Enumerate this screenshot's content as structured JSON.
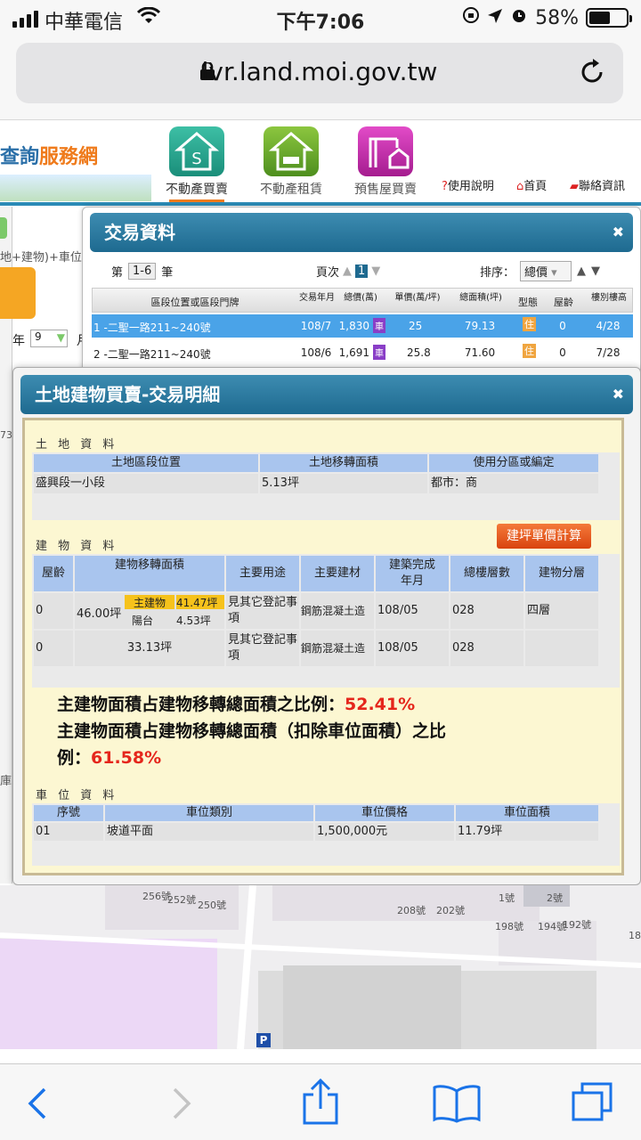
{
  "status": {
    "carrier": "中華電信",
    "time": "下午7:06",
    "battery": "58%"
  },
  "browser": {
    "url": "lvr.land.moi.gov.tw"
  },
  "site": {
    "logo_a": "查詢",
    "logo_b": "服務網",
    "nav": [
      "不動產買賣",
      "不動產租賃",
      "預售屋買賣"
    ],
    "links": [
      "使用說明",
      "首頁",
      "聯絡資訊"
    ]
  },
  "left": {
    "frag1": "地+建物)+車位",
    "year_label": "年",
    "month_val": "9",
    "month_label": "月",
    "f73": "73",
    "frag_sha": "庫"
  },
  "tx": {
    "title": "交易資料",
    "page_prefix": "第",
    "range": "1-6",
    "page_suffix": "筆",
    "page_label": "頁次",
    "page_num": "1",
    "sort_label": "排序：",
    "sort_value": "總價",
    "headers": [
      "區段位置或區段門牌",
      "交易年月",
      "總價(萬)",
      "單價(萬/坪)",
      "總面積(坪)",
      "型態",
      "屋齡",
      "樓別樓高"
    ],
    "rows": [
      {
        "addr": "1 -二聖一路211~240號",
        "ym": "108/7",
        "total": "1,830",
        "unit": "25",
        "area": "79.13",
        "type": "住",
        "age": "0",
        "floor": "4/28"
      },
      {
        "addr": "2 -二聖一路211~240號",
        "ym": "108/6",
        "total": "1,691",
        "unit": "25.8",
        "area": "71.60",
        "type": "住",
        "age": "0",
        "floor": "7/28"
      }
    ],
    "car_badge": "車"
  },
  "detail": {
    "title": "土地建物買賣-交易明細",
    "land": {
      "section": "土 地 資 料",
      "headers": [
        "土地區段位置",
        "土地移轉面積",
        "使用分區或編定"
      ],
      "row": [
        "盛興段一小段",
        "5.13坪",
        "都市：商"
      ]
    },
    "building": {
      "section": "建 物 資 料",
      "calc_button": "建坪單價計算",
      "headers": [
        "屋齡",
        "建物移轉面積",
        "主要用途",
        "主要建材",
        "建築完成年月",
        "總樓層數",
        "建物分層"
      ],
      "row1": {
        "age": "0",
        "area": "46.00坪",
        "main_label": "主建物",
        "main_val": "41.47坪",
        "bal_label": "陽台",
        "bal_val": "4.53坪",
        "use": "見其它登記事項",
        "material": "鋼筋混凝土造",
        "built": "108/05",
        "floors": "028",
        "layer": "四層"
      },
      "row2": {
        "age": "0",
        "area": "33.13坪",
        "use": "見其它登記事項",
        "material": "鋼筋混凝土造",
        "built": "108/05",
        "floors": "028",
        "layer": ""
      }
    },
    "ratio1_text": "主建物面積占建物移轉總面積之比例：",
    "ratio1_val": "52.41%",
    "ratio2_text_a": "主建物面積占建物移轉總面積（扣除車位面積）之比",
    "ratio2_text_b": "例：",
    "ratio2_val": "61.58%",
    "parking": {
      "section": "車 位 資 料",
      "headers": [
        "序號",
        "車位類別",
        "車位價格",
        "車位面積"
      ],
      "row": [
        "01",
        "坡道平面",
        "1,500,000元",
        "11.79坪"
      ]
    }
  },
  "map": {
    "labels": [
      "256號",
      "252號",
      "250號",
      "208號",
      "202號",
      "1號",
      "2號",
      "198號",
      "194號",
      "192號",
      "18",
      "P"
    ]
  },
  "colors": {
    "accent": "#2b8bb6",
    "highlight": "#e5261c",
    "row_selected": "#4aa3e8",
    "orange_btn": "#e9541a"
  }
}
